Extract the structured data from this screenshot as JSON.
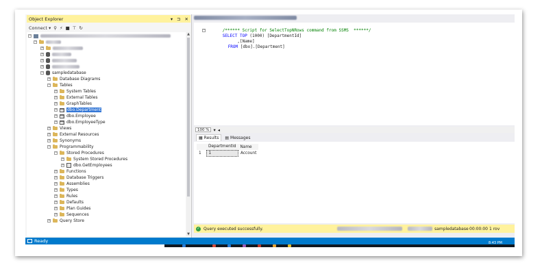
{
  "object_explorer": {
    "title": "Object Explorer",
    "title_controls": [
      "▾",
      "⊐",
      "✕"
    ],
    "connect_label": "Connect ▾",
    "toolbar_icons": [
      "filter-icon",
      "connect-object-icon",
      "disconnect-icon",
      "stop-icon",
      "refresh-icon"
    ],
    "tree": {
      "database": "sampledatabase",
      "database_diagrams": "Database Diagrams",
      "tables": "Tables",
      "system_tables": "System Tables",
      "external_tables": "External Tables",
      "graph_tables": "GraphTables",
      "table_department": "dbo.Department",
      "table_employee": "dbo.Employee",
      "table_employeetype": "dbo.EmployeeType",
      "views": "Views",
      "external_resources": "External Resources",
      "synonyms": "Synonyms",
      "programmability": "Programmability",
      "stored_procedures": "Stored Procedures",
      "system_stored_procedures": "System Stored Procedures",
      "sp_getemployees": "dbo.GetEmployees",
      "functions": "Functions",
      "database_triggers": "Database Triggers",
      "assemblies": "Assemblies",
      "types": "Types",
      "rules": "Rules",
      "defaults": "Defaults",
      "plan_guides": "Plan Guides",
      "sequences": "Sequences",
      "query_store": "Query Store"
    }
  },
  "editor": {
    "line1": "/****** Script for SelectTopNRows command from SSMS  ******/",
    "line2_kw": "SELECT TOP",
    "line2_rest": " (1000) [DepartmentId]",
    "line3": "      ,[Name]",
    "line4_kw": "FROM",
    "line4_rest": " [dbo].[Department]",
    "zoom": "100 %"
  },
  "results": {
    "tab_results": "Results",
    "tab_messages": "Messages",
    "columns": [
      "DepartmentId",
      "Name"
    ],
    "rows": [
      {
        "num": "1",
        "DepartmentId": "1",
        "Name": "Account"
      }
    ]
  },
  "status": {
    "message": "Query executed successfully.",
    "database": "sampledatabase",
    "elapsed": "00:00:00",
    "rows": "1 rov"
  },
  "statusbar": {
    "ready": "Ready"
  },
  "taskbar": {
    "time": "8:43 PM"
  },
  "colors": {
    "accent": "#007acc",
    "status_yellow": "#fff29d",
    "selection": "#3477d6"
  }
}
